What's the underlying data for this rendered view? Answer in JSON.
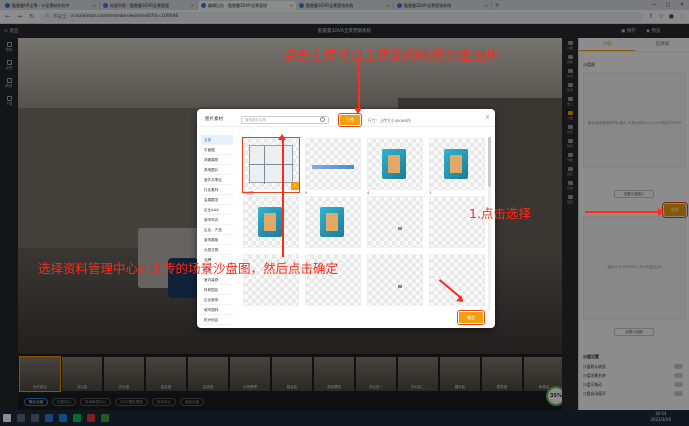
{
  "browser": {
    "tabs": [
      {
        "title": "酷雷曼VR全景 - vr全景制作软件",
        "active": false
      },
      {
        "title": "绘画列表 - 酷雷曼3DVR全景管理",
        "active": false
      },
      {
        "title": "编辑后台 - 酷雷曼3DVR全景管理",
        "active": true
      },
      {
        "title": "酷雷曼3DVR全景营销系统",
        "active": false
      },
      {
        "title": "酷雷曼3DVR全景营销系统",
        "active": false
      }
    ],
    "new_tab": "+",
    "security": "不安全",
    "url": "vr.kuleiman.com/member/work/edit?id=100046"
  },
  "editor": {
    "exit": "退出",
    "title": "酷雷曼3DVR全景营销系统",
    "save": "保存",
    "preview": "预览"
  },
  "left_rail": [
    {
      "label": "帮助",
      "icon": "help-icon"
    },
    {
      "label": "反馈",
      "icon": "feedback-icon"
    },
    {
      "label": "刷新",
      "icon": "refresh-icon"
    },
    {
      "label": "下载",
      "icon": "download-icon"
    }
  ],
  "tool_rail": [
    {
      "label": "基础",
      "icon": "basic-icon"
    },
    {
      "label": "视角",
      "icon": "view-icon"
    },
    {
      "label": "热点",
      "icon": "hotspot-icon"
    },
    {
      "label": "遮罩",
      "icon": "mask-icon"
    },
    {
      "label": "嵌入",
      "icon": "embed-icon"
    },
    {
      "label": "沙盘",
      "icon": "sandtable-icon",
      "active": true
    },
    {
      "label": "音乐",
      "icon": "music-icon"
    },
    {
      "label": "特效",
      "icon": "effect-icon"
    },
    {
      "label": "导航",
      "icon": "nav-icon"
    },
    {
      "label": "链接",
      "icon": "link-icon"
    },
    {
      "label": "足迹",
      "icon": "footprint-icon"
    },
    {
      "label": "按钮",
      "icon": "button-icon"
    }
  ],
  "right_panel": {
    "tabs": [
      "沙盘",
      "已添加"
    ],
    "section_title": "沙盘图",
    "hint": "建议使用透明的PNG图片,长宽比例为1:1,大小不超过300KB",
    "change_button": "设置沙盘图片",
    "choose_button": "替换",
    "preview_hint": "建议尺寸:800*800,大小不超过2M",
    "mark_button": "设置小地图",
    "settings_title": "沙盘设置",
    "settings": [
      "沙盘默认收起",
      "沙盘场景名称",
      "沙盘可拖动",
      "沙盘自动展开"
    ]
  },
  "thumbnails": [
    {
      "label": "大厅前台",
      "selected": true
    },
    {
      "label": "办公区"
    },
    {
      "label": "办公室"
    },
    {
      "label": "会议室"
    },
    {
      "label": "洽谈室"
    },
    {
      "label": "公司荣誉"
    },
    {
      "label": "前台区"
    },
    {
      "label": "总经理室"
    },
    {
      "label": "办公区一"
    },
    {
      "label": "办公区二"
    },
    {
      "label": "展示区"
    },
    {
      "label": "财务室"
    },
    {
      "label": "休息区"
    }
  ],
  "groups": [
    "默认分组",
    "行政中心",
    "技术研发中心",
    "2017团队看板",
    "设计中心",
    "添加分组"
  ],
  "progress_badge": "35%",
  "modal": {
    "title": "图片素材",
    "search_placeholder": "搜索图片名称",
    "upload_button": "上传",
    "note": "尺寸：上传大小300KB内",
    "close": "×",
    "categories": [
      "全部",
      "平面图",
      "场景建筑",
      "其他图片",
      "室外共享区",
      "行业素材",
      "会展展览",
      "企业AAA",
      "城市风光",
      "企业、产品",
      "宣传展板",
      "大型文物",
      "品牌",
      "形象",
      "室内装修",
      "科研园区",
      "企业服务",
      "城市园林",
      "杭州地区"
    ],
    "selected_category": 0,
    "images": [
      {
        "caption": "平面图",
        "kind": "plan",
        "selected": true
      },
      {
        "caption": "5",
        "kind": "strip"
      },
      {
        "caption": "4",
        "kind": "sand"
      },
      {
        "caption": "3",
        "kind": "sand"
      },
      {
        "caption": "",
        "kind": "sand"
      },
      {
        "caption": "",
        "kind": "sand"
      },
      {
        "caption": "",
        "kind": "dot"
      },
      {
        "caption": "",
        "kind": "blank"
      },
      {
        "caption": "",
        "kind": "blank"
      },
      {
        "caption": "",
        "kind": "blank"
      },
      {
        "caption": "",
        "kind": "dot"
      },
      {
        "caption": "",
        "kind": "blank"
      }
    ],
    "confirm_button": "确定"
  },
  "annotations": {
    "upload_tip": "点击上传可以上传新的场景沙盘图片",
    "choose_tip": "1.点击选择",
    "select_tip": "选择资料管理中心已上传的场景沙盘图，然后点击确定"
  },
  "taskbar": {
    "time": "16:54",
    "date": "2022/3/26"
  },
  "colors": {
    "accent": "#f3a00d",
    "annotation": "#ff2a1a",
    "active_category": "#3a7be0"
  }
}
